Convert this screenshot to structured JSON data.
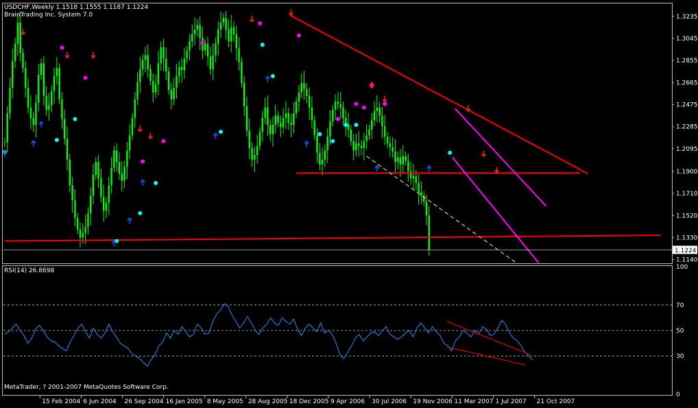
{
  "header": {
    "symbol_line": "USDCHF,Weekly  1.1518 1.1555 1.1187 1.1224",
    "system_line": "BrainTrading Inc. System 7.0"
  },
  "footer": {
    "copyright": "MetaTrader, ? 2001-2007 MetaQuotes Software Corp."
  },
  "colors": {
    "background": "#000000",
    "candles": "#00ff00",
    "trendline": "#ff0000",
    "channel": "#ff00ff",
    "dashed_support": "#ffff80",
    "rsi_line": "#1e90ff",
    "grid_dashed": "#c0c0c0",
    "arrow_up": "#0060ff",
    "arrow_down": "#ff2020",
    "dot_magenta": "#ff00ff",
    "dot_cyan": "#00ffff"
  },
  "chart_data": [
    {
      "type": "line",
      "title": "USDCHF,Weekly",
      "ohlc_last": {
        "open": 1.1518,
        "high": 1.1555,
        "low": 1.1187,
        "close": 1.1224
      },
      "x_tick_labels": [
        "15 Feb 2004",
        "6 Jun 2004",
        "26 Sep 2004",
        "16 Jan 2005",
        "8 May 2005",
        "28 Aug 2005",
        "18 Dec 2005",
        "9 Apr 2006",
        "30 Jul 2006",
        "19 Nov 2006",
        "11 Mar 2007",
        "1 Jul 2007",
        "21 Oct 2007"
      ],
      "y_ticks": [
        "1.3235",
        "1.3045",
        "1.2855",
        "1.2665",
        "1.2475",
        "1.2285",
        "1.2095",
        "1.1900",
        "1.1710",
        "1.1520",
        "1.1330",
        "1.1140"
      ],
      "ylim": [
        1.112,
        1.334
      ],
      "current_price_label": "1.1224",
      "series": [
        {
          "values": [
            1.215,
            1.24,
            1.262,
            1.285,
            1.3,
            1.318,
            1.292,
            1.279,
            1.262,
            1.245,
            1.236,
            1.23,
            1.249,
            1.273,
            1.283,
            1.255,
            1.243,
            1.247,
            1.259,
            1.272,
            1.279,
            1.252,
            1.235,
            1.218,
            1.2,
            1.178,
            1.165,
            1.15,
            1.14,
            1.133,
            1.137,
            1.142,
            1.154,
            1.169,
            1.187,
            1.198,
            1.184,
            1.168,
            1.156,
            1.163,
            1.178,
            1.193,
            1.208,
            1.198,
            1.188,
            1.182,
            1.194,
            1.208,
            1.221,
            1.236,
            1.252,
            1.267,
            1.278,
            1.286,
            1.29,
            1.278,
            1.268,
            1.258,
            1.265,
            1.283,
            1.297,
            1.287,
            1.276,
            1.26,
            1.252,
            1.262,
            1.272,
            1.28,
            1.277,
            1.287,
            1.294,
            1.302,
            1.308,
            1.312,
            1.316,
            1.305,
            1.294,
            1.3,
            1.289,
            1.278,
            1.29,
            1.3,
            1.312,
            1.318,
            1.322,
            1.312,
            1.302,
            1.314,
            1.308,
            1.296,
            1.284,
            1.266,
            1.246,
            1.225,
            1.21,
            1.2,
            1.204,
            1.212,
            1.224,
            1.236,
            1.245,
            1.23,
            1.222,
            1.23,
            1.238,
            1.232,
            1.228,
            1.236,
            1.24,
            1.232,
            1.23,
            1.24,
            1.25,
            1.258,
            1.266,
            1.261,
            1.255,
            1.245,
            1.234,
            1.221,
            1.206,
            1.196,
            1.2,
            1.208,
            1.22,
            1.233,
            1.243,
            1.25,
            1.248,
            1.245,
            1.236,
            1.231,
            1.226,
            1.216,
            1.208,
            1.214,
            1.212,
            1.21,
            1.216,
            1.221,
            1.226,
            1.234,
            1.242,
            1.245,
            1.238,
            1.229,
            1.22,
            1.214,
            1.211,
            1.207,
            1.198,
            1.202,
            1.196,
            1.203,
            1.199,
            1.19,
            1.184,
            1.186,
            1.18,
            1.172,
            1.169,
            1.164,
            1.152,
            1.1224
          ],
          "min": 1.1187,
          "max": 1.3235
        }
      ],
      "signals": {
        "up_arrows": [
          [
            0,
            1.2045
          ],
          [
            11,
            1.2135
          ],
          [
            14,
            1.23
          ],
          [
            42,
            1.1275
          ],
          [
            48,
            1.147
          ],
          [
            53,
            1.18
          ],
          [
            81,
            1.22
          ],
          [
            101,
            1.269
          ],
          [
            116,
            1.213
          ],
          [
            143,
            1.192
          ],
          [
            163,
            1.192
          ]
        ],
        "down_arrows": [
          [
            7,
            1.31
          ],
          [
            24,
            1.29
          ],
          [
            34,
            1.29
          ],
          [
            52,
            1.2265
          ],
          [
            56,
            1.2205
          ],
          [
            95,
            1.321
          ],
          [
            110,
            1.3265
          ],
          [
            141,
            1.264
          ],
          [
            146,
            1.252
          ],
          [
            178,
            1.244
          ],
          [
            184,
            1.205
          ],
          [
            189,
            1.191
          ]
        ],
        "magenta_dots": [
          [
            22,
            1.2965
          ],
          [
            31,
            1.2705
          ],
          [
            53,
            1.1985
          ],
          [
            61,
            1.216
          ],
          [
            76,
            1.3005
          ],
          [
            98,
            1.3175
          ],
          [
            113,
            1.307
          ],
          [
            128,
            1.235
          ],
          [
            135,
            1.248
          ],
          [
            138,
            1.245
          ],
          [
            141,
            1.2645
          ],
          [
            146,
            1.248
          ]
        ],
        "cyan_dots": [
          [
            0,
            1.2065
          ],
          [
            20,
            1.217
          ],
          [
            27,
            1.235
          ],
          [
            43,
            1.13
          ],
          [
            52,
            1.154
          ],
          [
            58,
            1.18
          ],
          [
            83,
            1.224
          ],
          [
            99,
            1.299
          ],
          [
            103,
            1.272
          ],
          [
            121,
            1.222
          ],
          [
            126,
            1.216
          ],
          [
            131,
            1.23
          ],
          [
            135,
            1.23
          ],
          [
            171,
            1.206
          ]
        ]
      },
      "trendlines": [
        {
          "color": "red",
          "from": [
            110,
            1.324
          ],
          "to": [
            224,
            1.188
          ]
        },
        {
          "color": "red",
          "from": [
            0,
            1.13
          ],
          "to": [
            252,
            1.135
          ]
        },
        {
          "color": "red",
          "from": [
            112,
            1.1885
          ],
          "to": [
            221,
            1.1885
          ]
        },
        {
          "color": "magenta",
          "from": [
            173,
            1.244
          ],
          "to": [
            208,
            1.16
          ]
        },
        {
          "color": "magenta",
          "from": [
            172,
            1.202
          ],
          "to": [
            205,
            1.1115
          ]
        },
        {
          "color": "yellow-dashed",
          "from": [
            139,
            1.203
          ],
          "to": [
            196,
            1.112
          ]
        }
      ]
    },
    {
      "type": "line",
      "title": "RSI(14) 26.8698",
      "ylim": [
        0,
        100
      ],
      "y_ticks": [
        "100",
        "70",
        "50",
        "30",
        "0"
      ],
      "grid_levels": [
        70,
        50,
        30
      ],
      "series": [
        {
          "values": [
            47,
            49,
            52,
            55,
            50,
            46,
            40,
            44,
            51,
            54,
            50,
            45,
            42,
            41,
            38,
            36,
            34,
            41,
            46,
            52,
            55,
            49,
            44,
            52,
            47,
            44,
            48,
            55,
            49,
            45,
            40,
            38,
            36,
            32,
            30,
            28,
            25,
            22,
            27,
            31,
            38,
            41,
            48,
            44,
            50,
            47,
            53,
            49,
            45,
            47,
            55,
            52,
            47,
            48,
            57,
            63,
            66,
            71,
            69,
            62,
            57,
            52,
            56,
            61,
            56,
            50,
            47,
            52,
            55,
            60,
            56,
            54,
            60,
            57,
            55,
            59,
            51,
            46,
            52,
            55,
            52,
            49,
            56,
            48,
            50,
            47,
            40,
            31,
            28,
            33,
            38,
            44,
            47,
            42,
            45,
            48,
            49,
            46,
            50,
            53,
            47,
            45,
            43,
            45,
            48,
            50,
            45,
            52,
            56,
            52,
            48,
            53,
            49,
            46,
            40,
            38,
            34,
            42,
            45,
            50,
            48,
            45,
            50,
            47,
            53,
            51,
            46,
            47,
            52,
            58,
            55,
            48,
            44,
            42,
            38,
            33,
            30,
            27
          ],
          "last": 26.8698
        }
      ],
      "trendlines": [
        {
          "color": "red",
          "from": [
            170,
            57
          ],
          "to": [
            202,
            31
          ]
        },
        {
          "color": "red",
          "from": [
            170,
            37
          ],
          "to": [
            200,
            23
          ]
        }
      ]
    }
  ]
}
